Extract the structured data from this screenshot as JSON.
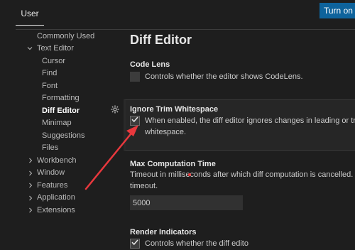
{
  "header": {
    "tab_user": "User",
    "sync_button": "Turn on S"
  },
  "sidebar": {
    "items": [
      {
        "label": "Commonly Used",
        "level": 0,
        "expandable": false
      },
      {
        "label": "Text Editor",
        "level": 0,
        "expandable": true,
        "expanded": true
      },
      {
        "label": "Cursor",
        "level": 1
      },
      {
        "label": "Find",
        "level": 1
      },
      {
        "label": "Font",
        "level": 1
      },
      {
        "label": "Formatting",
        "level": 1
      },
      {
        "label": "Diff Editor",
        "level": 1,
        "active": true
      },
      {
        "label": "Minimap",
        "level": 1
      },
      {
        "label": "Suggestions",
        "level": 1
      },
      {
        "label": "Files",
        "level": 1
      },
      {
        "label": "Workbench",
        "level": 0,
        "expandable": true
      },
      {
        "label": "Window",
        "level": 0,
        "expandable": true
      },
      {
        "label": "Features",
        "level": 0,
        "expandable": true
      },
      {
        "label": "Application",
        "level": 0,
        "expandable": true
      },
      {
        "label": "Extensions",
        "level": 0,
        "expandable": true
      }
    ]
  },
  "main": {
    "section_title": "Diff Editor",
    "settings": {
      "code_lens": {
        "title": "Code Lens",
        "description": "Controls whether the editor shows CodeLens.",
        "checked": false
      },
      "ignore_trim": {
        "title": "Ignore Trim Whitespace",
        "description_line1": "When enabled, the diff editor ignores changes in leading or traili",
        "description_line2": "whitespace.",
        "checked": true
      },
      "max_computation": {
        "title": "Max Computation Time",
        "description_line1": "Timeout in milliseconds after which diff computation is cancelled. Use",
        "description_line2": "timeout.",
        "value": "5000"
      },
      "render_indicators": {
        "title": "Render Indicators",
        "description": "Controls whether the diff edito",
        "checked": true
      }
    }
  },
  "icons": {
    "check": "check-icon",
    "gear": "gear-icon",
    "chevron_down": "chevron-down-icon",
    "chevron_right": "chevron-right-icon"
  },
  "colors": {
    "accent_button": "#0e639c",
    "annotation_arrow": "#e8383d",
    "background": "#1e1e1e"
  }
}
